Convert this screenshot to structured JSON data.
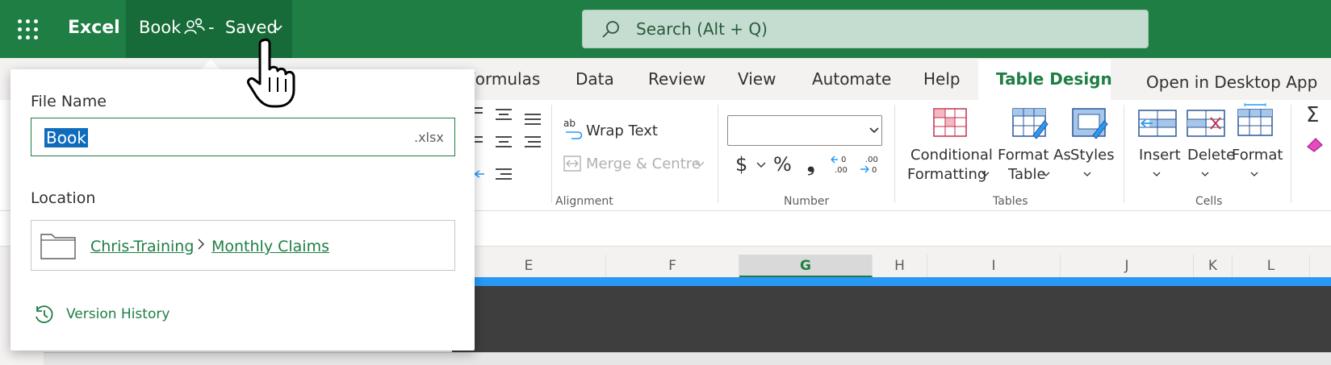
{
  "titlebar": {
    "app_name": "Excel",
    "book_name": "Book",
    "saved_status": "-  Saved",
    "search_placeholder": "Search (Alt + Q)",
    "bg_color": "#1e7e44"
  },
  "ribbon_tabs": {
    "items": [
      "Formulas",
      "Data",
      "Review",
      "View",
      "Automate",
      "Help"
    ],
    "active": "Table Design",
    "open_desktop": "Open in Desktop App"
  },
  "ribbon": {
    "wrap_text": "Wrap Text",
    "merge_centre": "Merge & Centre",
    "alignment_label": "Alignment",
    "number_label": "Number",
    "number_symbols": [
      "$",
      "%",
      "❟"
    ],
    "conditional_formatting": [
      "Conditional",
      "Formatting"
    ],
    "format_as_table": [
      "Format As",
      "Table"
    ],
    "styles": "Styles",
    "tables_label": "Tables",
    "insert": "Insert",
    "delete": "Delete",
    "format": "Format",
    "cells_label": "Cells"
  },
  "columns": [
    "E",
    "F",
    "G",
    "H",
    "I",
    "J",
    "K",
    "L"
  ],
  "active_column": "G",
  "file_panel": {
    "file_name_label": "File Name",
    "file_name_value": "Book",
    "file_extension": ".xlsx",
    "location_label": "Location",
    "location_path": [
      "Chris-Training",
      "Monthly Claims"
    ],
    "version_history": "Version History"
  },
  "icons": {
    "waffle": "app-launcher-icon",
    "people": "shared-people-icon",
    "search": "search-icon",
    "folder": "folder-icon",
    "history": "history-icon",
    "cursor": "hand-pointer-cursor-icon"
  }
}
